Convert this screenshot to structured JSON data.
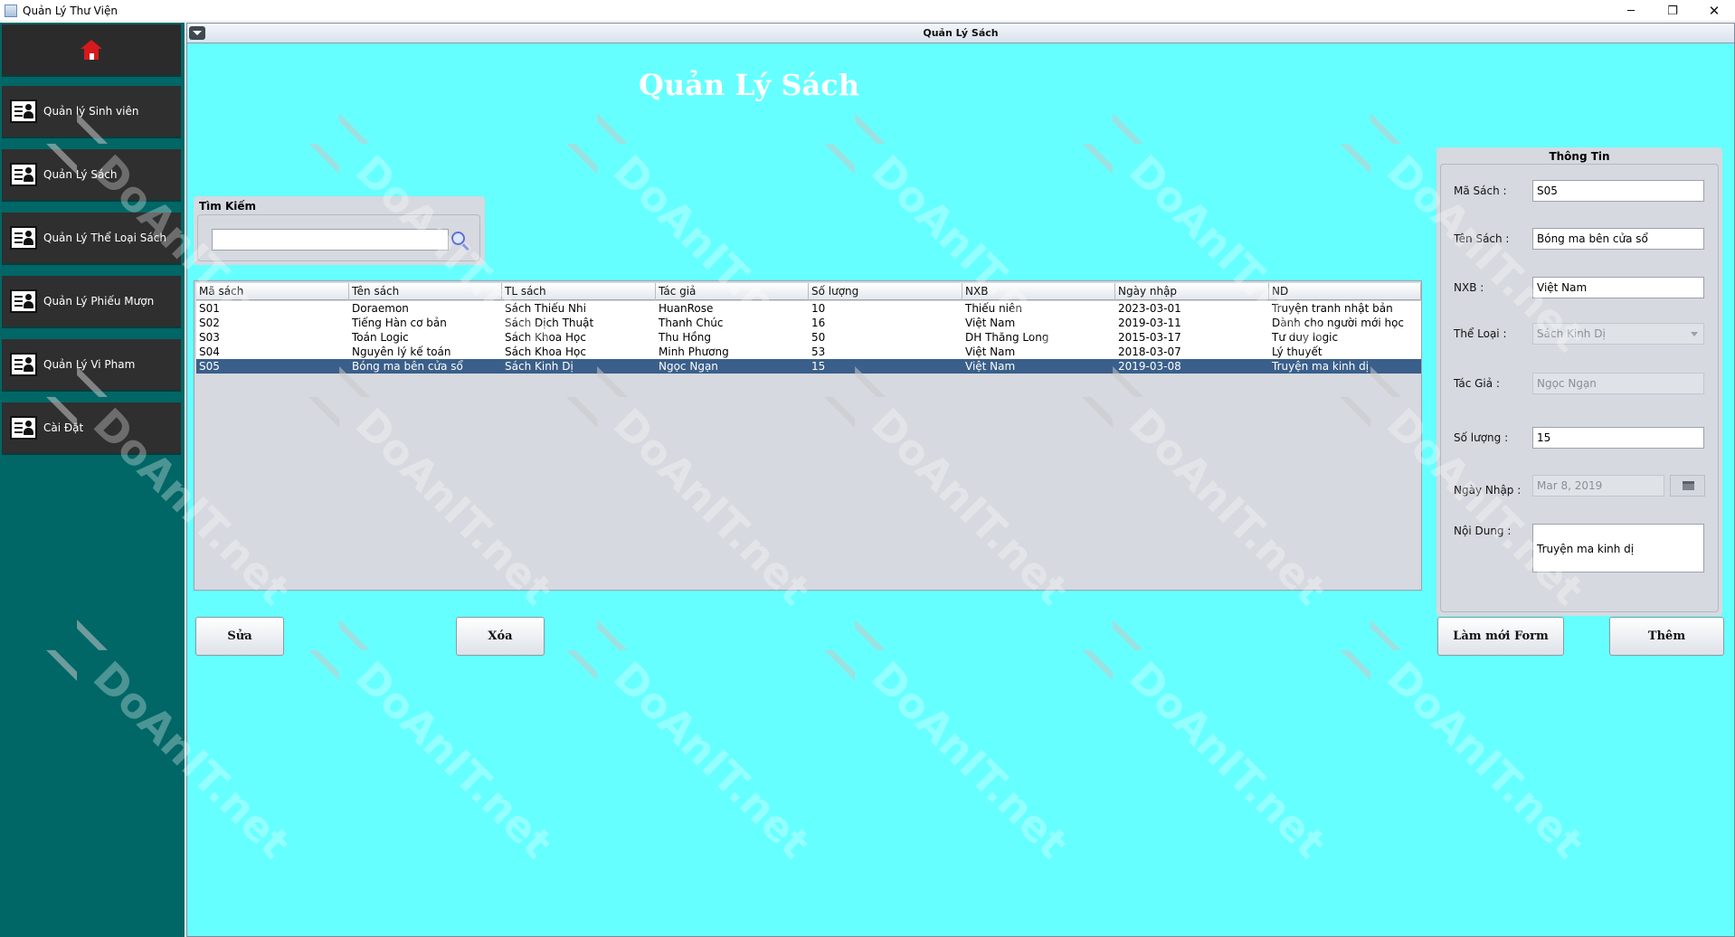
{
  "window": {
    "title": "Quản Lý Thư Viện",
    "controls": {
      "minimize": "─",
      "maximize": "❐",
      "close": "✕"
    }
  },
  "sidebar": {
    "home_icon": "home-icon",
    "items": [
      {
        "label": "Quản lý Sinh viên",
        "icon": "user-card-icon"
      },
      {
        "label": "Quản Lý Sách",
        "icon": "user-card-icon"
      },
      {
        "label": "Quản Lý Thể Loại Sách",
        "icon": "user-card-icon"
      },
      {
        "label": "Quản Lý Phiếu Mượn",
        "icon": "user-card-icon"
      },
      {
        "label": "Quản Lý Vi Pham",
        "icon": "user-card-icon"
      },
      {
        "label": "Cài Đặt",
        "icon": "user-card-icon"
      }
    ]
  },
  "frame": {
    "title": "Quản Lý Sách",
    "heading": "Quản Lý Sách"
  },
  "search": {
    "title": "Tìm Kiếm",
    "value": "",
    "icon": "search-icon"
  },
  "table": {
    "columns": [
      "Mã sách",
      "Tên sách",
      "TL sách",
      "Tác giả",
      "Số lượng",
      "NXB",
      "Ngày nhập",
      "ND"
    ],
    "rows": [
      [
        "S01",
        "Doraemon",
        "Sách Thiếu Nhi",
        "HuanRose",
        "10",
        "Thiếu niên",
        "2023-03-01",
        "Truyện tranh nhật bản"
      ],
      [
        "S02",
        "Tiếng Hàn cơ bản",
        "Sách Dịch Thuật",
        "Thanh Chúc",
        "16",
        "Việt Nam",
        "2019-03-11",
        "Dành cho người mới học"
      ],
      [
        "S03",
        "Toán Logic",
        "Sách Khoa Học",
        "Thu Hồng",
        "50",
        "DH Thăng Long",
        "2015-03-17",
        "Tư duy logic"
      ],
      [
        "S04",
        "Nguyên lý kế toán",
        "Sách Khoa Học",
        "Minh Phương",
        "53",
        "Việt Nam",
        "2018-03-07",
        "Lý thuyết"
      ],
      [
        "S05",
        "Bóng ma bên cửa sổ",
        "Sách Kinh Dị",
        "Ngọc Ngạn",
        "15",
        "Việt Nam",
        "2019-03-08",
        "Truyện ma kinh dị"
      ]
    ],
    "selected_index": 4
  },
  "info": {
    "title": "Thông Tin",
    "fields": {
      "ma_sach": {
        "label": "Mã Sách :",
        "value": "S05"
      },
      "ten_sach": {
        "label": "Tên Sách :",
        "value": "Bóng ma bên cửa sổ"
      },
      "nxb": {
        "label": "NXB :",
        "value": "Việt Nam"
      },
      "the_loai": {
        "label": "Thể Loại :",
        "value": "Sách Kinh Dị"
      },
      "tac_gia": {
        "label": "Tác Giả :",
        "value": "Ngọc Ngạn"
      },
      "so_luong": {
        "label": "Số lượng :",
        "value": "15"
      },
      "ngay_nhap": {
        "label": "Ngày Nhập :",
        "value": "Mar 8, 2019"
      },
      "noi_dung": {
        "label": "Nội Dung :",
        "value": "Truyện ma kinh dị"
      }
    }
  },
  "buttons": {
    "sua": "Sửa",
    "xoa": "Xóa",
    "lam_moi": "Làm mới Form",
    "them": "Thêm"
  },
  "colors": {
    "sidebar_bg": "#006666",
    "content_bg": "#66ffff",
    "selected_row": "#3a5f8a"
  },
  "watermark": "DoAnIT.net"
}
